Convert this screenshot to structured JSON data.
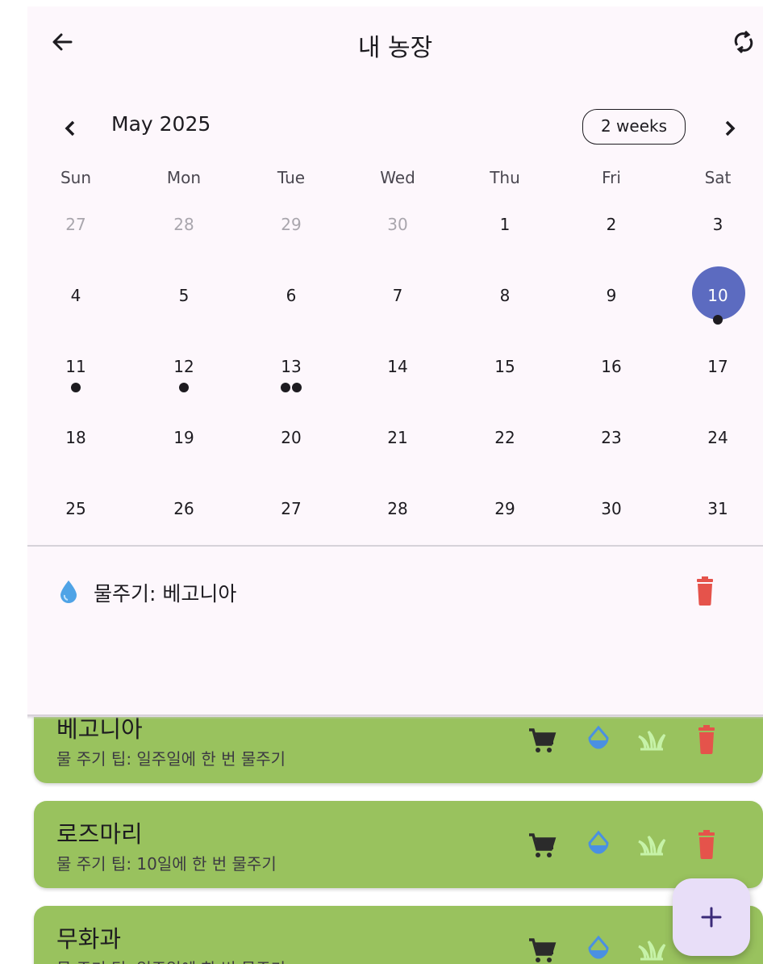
{
  "appbar": {
    "title": "내 농장",
    "back_icon": "arrow-back-icon",
    "refresh_icon": "sync-icon"
  },
  "calendar": {
    "month_label": "May 2025",
    "format_button": "2 weeks",
    "weekdays": [
      "Sun",
      "Mon",
      "Tue",
      "Wed",
      "Thu",
      "Fri",
      "Sat"
    ],
    "selected_day": "10",
    "selected_color": "#5c6bc0",
    "weeks": [
      [
        {
          "d": "27",
          "out": true,
          "m": 0
        },
        {
          "d": "28",
          "out": true,
          "m": 0
        },
        {
          "d": "29",
          "out": true,
          "m": 0
        },
        {
          "d": "30",
          "out": true,
          "m": 0
        },
        {
          "d": "1",
          "out": false,
          "m": 0
        },
        {
          "d": "2",
          "out": false,
          "m": 0
        },
        {
          "d": "3",
          "out": false,
          "m": 0
        }
      ],
      [
        {
          "d": "4",
          "out": false,
          "m": 0
        },
        {
          "d": "5",
          "out": false,
          "m": 0
        },
        {
          "d": "6",
          "out": false,
          "m": 0
        },
        {
          "d": "7",
          "out": false,
          "m": 0
        },
        {
          "d": "8",
          "out": false,
          "m": 0
        },
        {
          "d": "9",
          "out": false,
          "m": 0
        },
        {
          "d": "10",
          "out": false,
          "m": 1,
          "sel": true
        }
      ],
      [
        {
          "d": "11",
          "out": false,
          "m": 1
        },
        {
          "d": "12",
          "out": false,
          "m": 1
        },
        {
          "d": "13",
          "out": false,
          "m": 2
        },
        {
          "d": "14",
          "out": false,
          "m": 0
        },
        {
          "d": "15",
          "out": false,
          "m": 0
        },
        {
          "d": "16",
          "out": false,
          "m": 0
        },
        {
          "d": "17",
          "out": false,
          "m": 0
        }
      ],
      [
        {
          "d": "18",
          "out": false,
          "m": 0
        },
        {
          "d": "19",
          "out": false,
          "m": 0
        },
        {
          "d": "20",
          "out": false,
          "m": 0
        },
        {
          "d": "21",
          "out": false,
          "m": 0
        },
        {
          "d": "22",
          "out": false,
          "m": 0
        },
        {
          "d": "23",
          "out": false,
          "m": 0
        },
        {
          "d": "24",
          "out": false,
          "m": 0
        }
      ],
      [
        {
          "d": "25",
          "out": false,
          "m": 0
        },
        {
          "d": "26",
          "out": false,
          "m": 0
        },
        {
          "d": "27",
          "out": false,
          "m": 0
        },
        {
          "d": "28",
          "out": false,
          "m": 0
        },
        {
          "d": "29",
          "out": false,
          "m": 0
        },
        {
          "d": "30",
          "out": false,
          "m": 0
        },
        {
          "d": "31",
          "out": false,
          "m": 0
        }
      ]
    ]
  },
  "events": [
    {
      "label": "물주기: 베고니아",
      "icon": "water-drop-icon",
      "action_icon": "trash-icon"
    }
  ],
  "plants": [
    {
      "name": "베고니아",
      "tip": "물 주기 팁: 일주일에 한 번 물주기",
      "show_delete": true
    },
    {
      "name": "로즈마리",
      "tip": "물 주기 팁: 10일에 한 번 물주기",
      "show_delete": true
    },
    {
      "name": "무화과",
      "tip": "물 주기 팁: 일주일에 한 번 물주기",
      "show_delete": false
    }
  ],
  "plant_actions": [
    "shopping-cart-icon",
    "water-level-icon",
    "grass-icon",
    "trash-icon"
  ],
  "colors": {
    "card": "#99c25e",
    "delete": "#e5534b",
    "water": "#4a90e2",
    "sprout": "#c6f2a8",
    "fab": "#e8def8"
  },
  "fab": {
    "icon": "plus-icon"
  }
}
